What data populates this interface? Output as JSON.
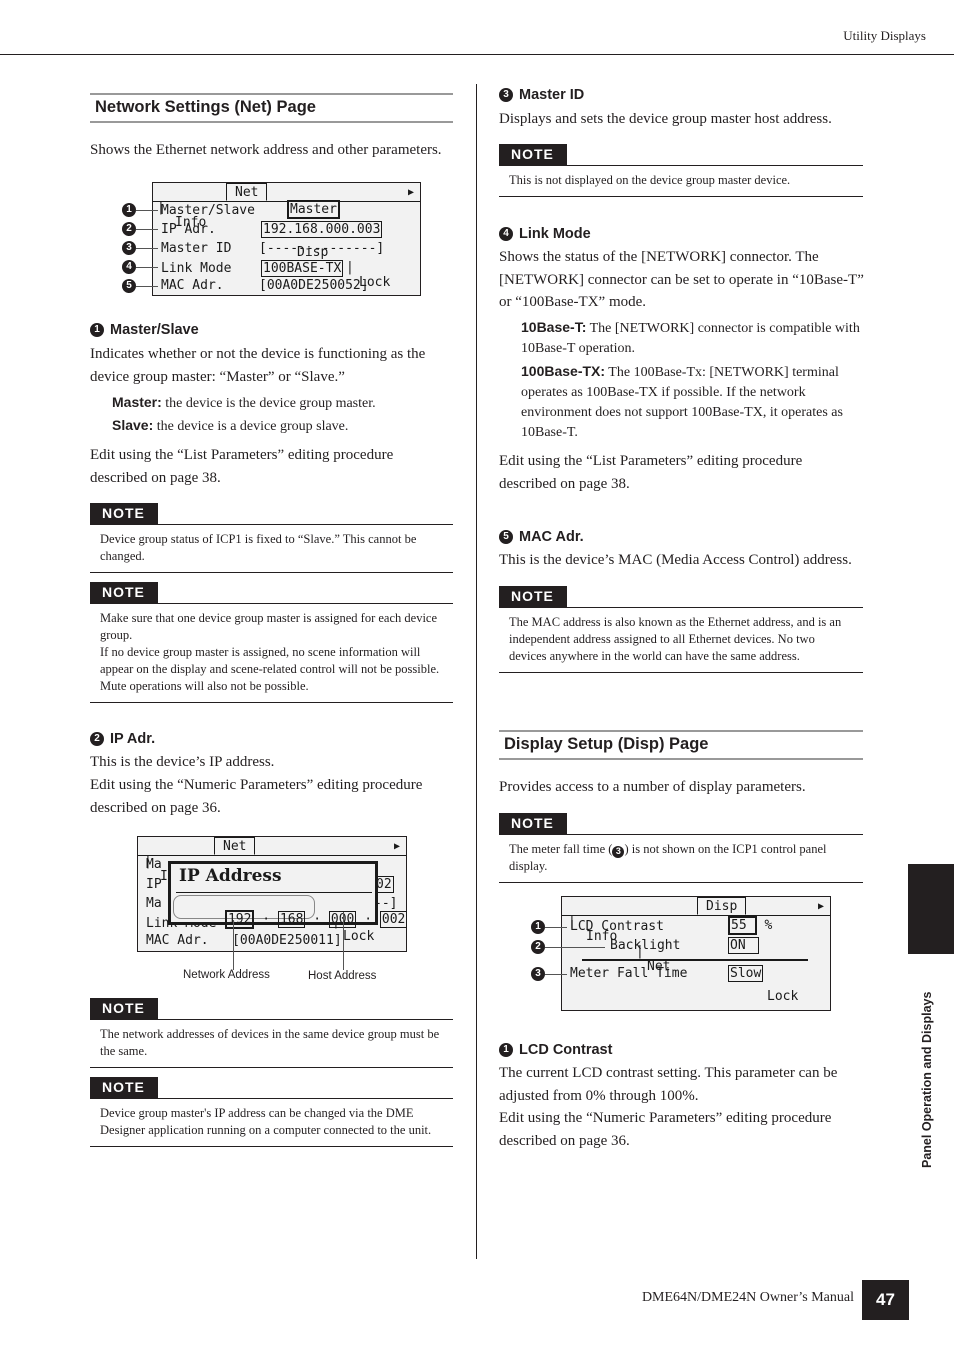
{
  "header": {
    "section": "Utility Displays"
  },
  "left": {
    "section_title": "Network Settings (Net) Page",
    "intro": "Shows the Ethernet network address and other parameters.",
    "lcd_net": {
      "tabs": [
        "Info",
        "Net",
        "Disp",
        "Lock"
      ],
      "active_tab": "Net",
      "rows": [
        {
          "num": "1",
          "label": "Master/Slave",
          "value": "Master"
        },
        {
          "num": "2",
          "label": "IP Adr.",
          "value": "192.168.000.003"
        },
        {
          "num": "3",
          "label": "Master ID",
          "value": "[--------------]"
        },
        {
          "num": "4",
          "label": "Link Mode",
          "value": "100BASE-TX"
        },
        {
          "num": "5",
          "label": "MAC Adr.",
          "value": "[00A0DE250052]"
        }
      ]
    },
    "item1": {
      "num": "1",
      "title": "Master/Slave",
      "body": "Indicates whether or not the device is functioning as the device group master: “Master” or “Slave.”",
      "defs": [
        {
          "term": "Master:",
          "text": "the device is the device group master."
        },
        {
          "term": "Slave:",
          "text": "the device is a device group slave."
        }
      ],
      "edit": "Edit using the “List Parameters” editing procedure described on page 38."
    },
    "notes1": [
      {
        "label": "NOTE",
        "text": "Device group status of ICP1 is fixed to “Slave.” This cannot be changed."
      },
      {
        "label": "NOTE",
        "text": "Make sure that one device group master is assigned for each device group.",
        "text2": "If no device group master is assigned, no scene information will appear on the display and scene-related control will not be possible. Mute operations will also not be possible."
      }
    ],
    "item2": {
      "num": "2",
      "title": "IP Adr.",
      "line1": "This is the device’s IP address.",
      "edit": "Edit using the “Numeric Parameters” editing procedure described on page 36."
    },
    "lcd_ip": {
      "tabs": [
        "Info",
        "Net",
        "Disp",
        "Lock"
      ],
      "popup_title": "IP Address",
      "octets": [
        "192",
        "168",
        "000",
        "002"
      ],
      "bg_rows": [
        "Ma",
        "IP",
        "Ma",
        "Link Mode",
        "MAC Adr.   [00A0DE250011]"
      ],
      "bg_ip_tail": "02",
      "bg_mid_tail": "--]",
      "caption_network": "Network Address",
      "caption_host": "Host Address"
    },
    "notes2": [
      {
        "label": "NOTE",
        "text": "The network addresses of devices in the same device group must be the same."
      },
      {
        "label": "NOTE",
        "text": "Device group master's IP address can be changed via the DME Designer application running on a computer connected to the unit."
      }
    ]
  },
  "right": {
    "item3": {
      "num": "3",
      "title": "Master ID",
      "body": "Displays and sets the device group master host address.",
      "note": {
        "label": "NOTE",
        "text": "This is not displayed on the device group master device."
      }
    },
    "item4": {
      "num": "4",
      "title": "Link Mode",
      "body": "Shows the status of the [NETWORK] connector. The [NETWORK] connector can be set to operate in “10Base-T” or “100Base-TX” mode.",
      "defs": [
        {
          "term": "10Base-T:",
          "text": "The [NETWORK] connector is compatible with 10Base-T operation."
        },
        {
          "term": "100Base-TX:",
          "text": "The 100Base-Tx: [NETWORK] terminal operates as 100Base-TX if possible. If the network environment does not support 100Base-TX, it operates as 10Base-T."
        }
      ],
      "edit": "Edit using the “List Parameters” editing procedure described on page 38."
    },
    "item5": {
      "num": "5",
      "title": "MAC Adr.",
      "body": "This is the device’s MAC (Media Access Control) address.",
      "note": {
        "label": "NOTE",
        "text": "The MAC address is also known as the Ethernet address, and is an independent address assigned to all Ethernet devices. No two devices anywhere in the world can have the same address."
      }
    },
    "disp_section": {
      "title": "Display Setup (Disp) Page",
      "intro": "Provides access to a number of display parameters.",
      "note": {
        "label": "NOTE",
        "text_before": "The meter fall time (",
        "ref": "3",
        "text_after": ") is not shown on the ICP1 control panel display."
      }
    },
    "lcd_disp": {
      "tabs": [
        "Info",
        "Net",
        "Disp",
        "Lock"
      ],
      "active_tab": "Disp",
      "rows": [
        {
          "num": "1",
          "label": "LCD Contrast",
          "value": "55",
          "unit": "%"
        },
        {
          "num": "2",
          "label": "Backlight",
          "value": "ON"
        },
        {
          "num": "3",
          "label": "Meter Fall Time",
          "value": "Slow"
        }
      ]
    },
    "lcd_contrast": {
      "num": "1",
      "title": "LCD Contrast",
      "body": "The current LCD contrast setting. This parameter can be adjusted from 0% through 100%.",
      "edit": "Edit using the “Numeric Parameters” editing procedure described on page 36."
    }
  },
  "side_tab": {
    "label": "Panel Operation and Displays"
  },
  "footer": {
    "manual": "DME64N/DME24N Owner’s Manual",
    "page": "47"
  }
}
